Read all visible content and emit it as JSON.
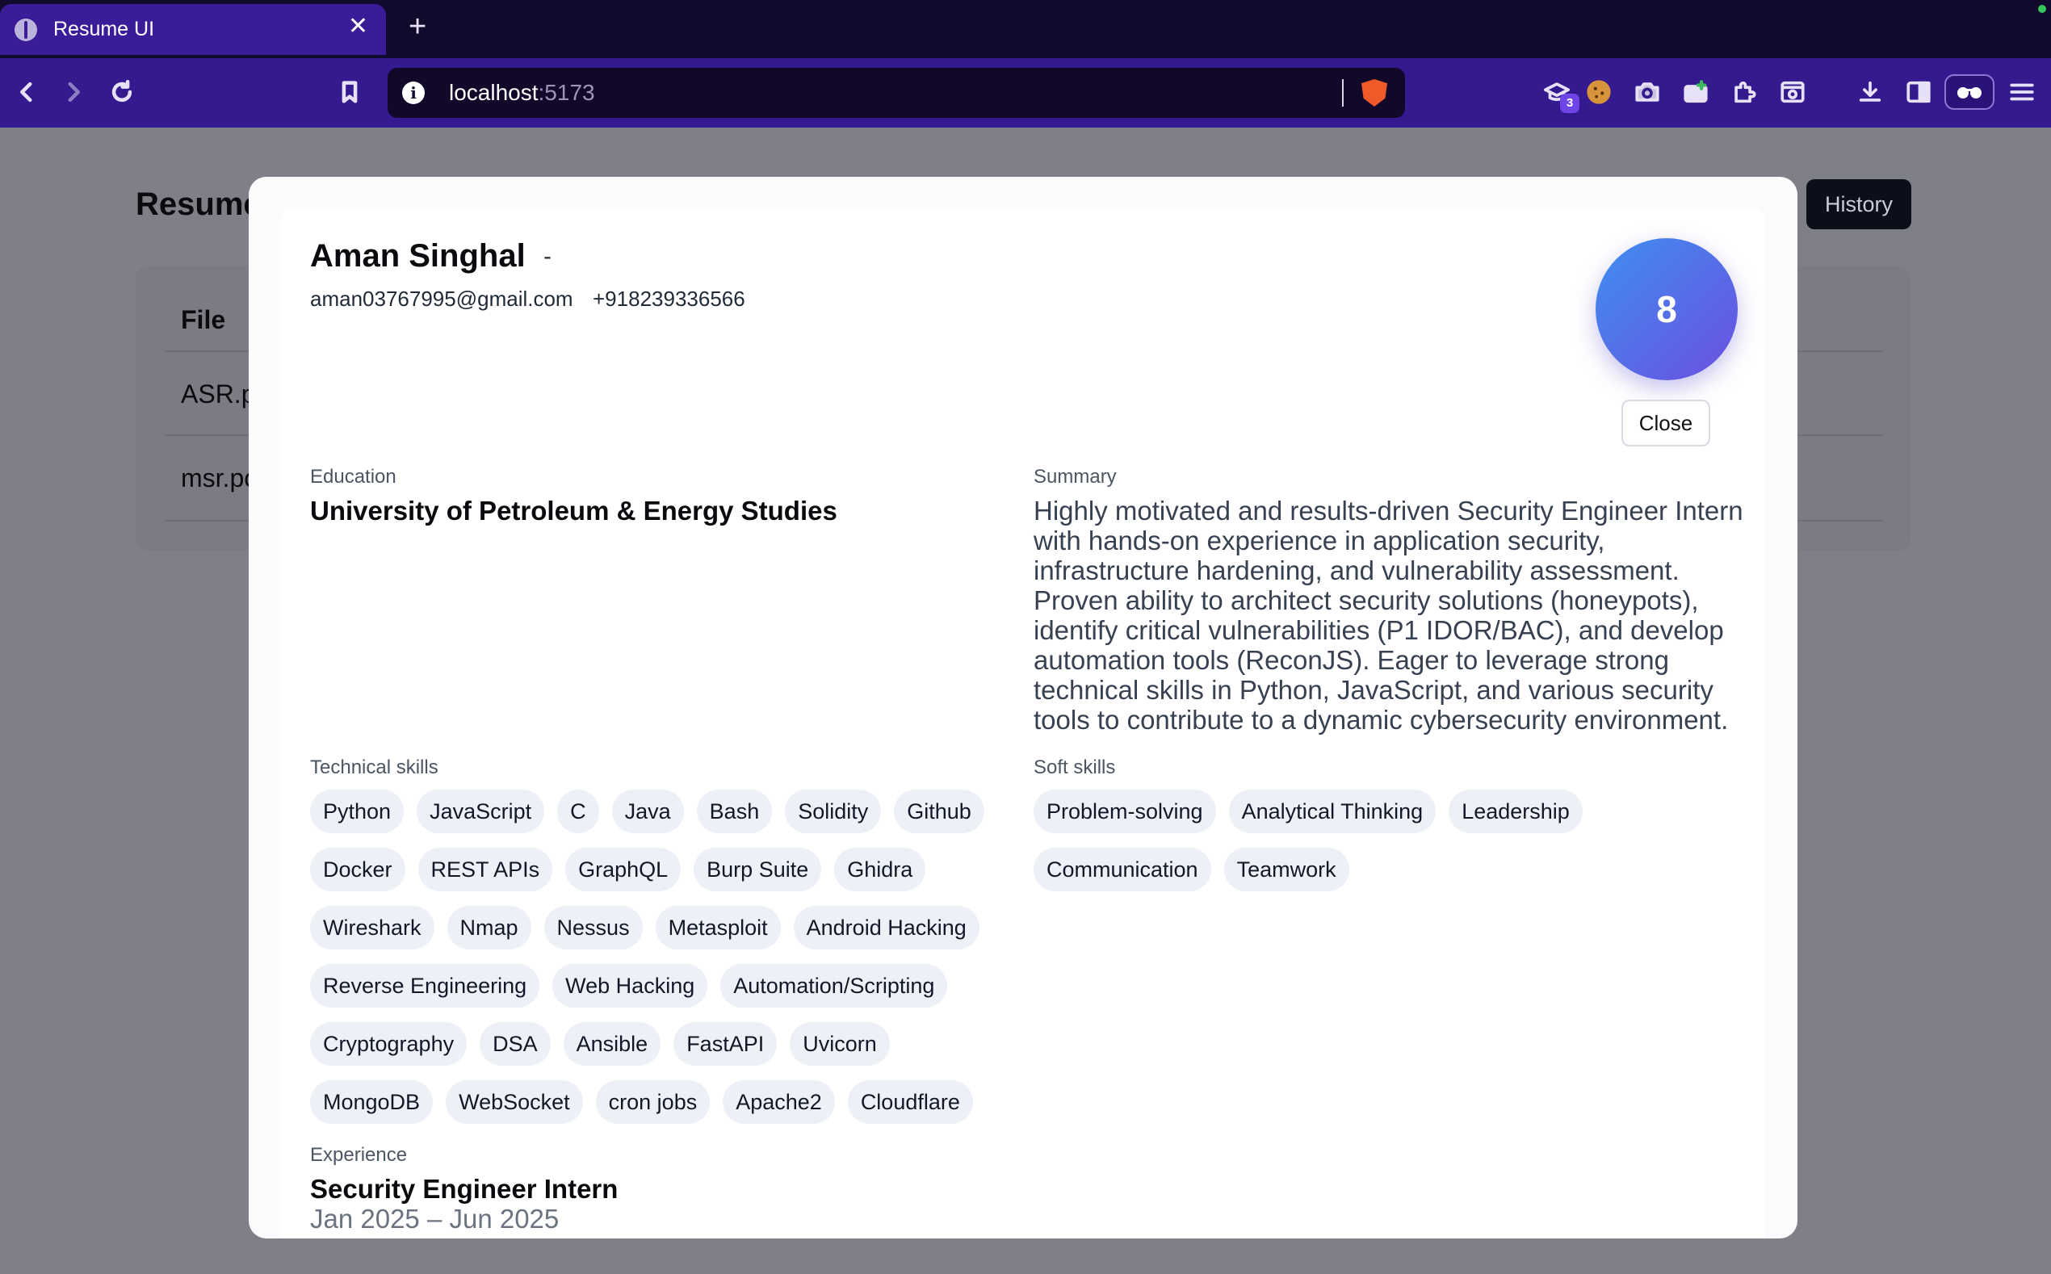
{
  "browser": {
    "tab_title": "Resume UI",
    "url_host": "localhost",
    "url_port": ":5173",
    "extension_badge": "3"
  },
  "page": {
    "title": "Resume",
    "history_label": "History",
    "table_header": "File",
    "rows": [
      "ASR.p",
      "msr.pc"
    ]
  },
  "modal": {
    "name": "Aman Singhal",
    "dash": "-",
    "email": "aman03767995@gmail.com",
    "phone": "+918239336566",
    "score": "8",
    "close_label": "Close",
    "education_label": "Education",
    "education": "University of Petroleum & Energy Studies",
    "summary_label": "Summary",
    "summary": "Highly motivated and results-driven Security Engineer Intern with hands-on experience in application security, infrastructure hardening, and vulnerability assessment. Proven ability to architect security solutions (honeypots), identify critical vulnerabilities (P1 IDOR/BAC), and develop automation tools (ReconJS). Eager to leverage strong technical skills in Python, JavaScript, and various security tools to contribute to a dynamic cybersecurity environment.",
    "technical_label": "Technical skills",
    "technical_skills": [
      "Python",
      "JavaScript",
      "C",
      "Java",
      "Bash",
      "Solidity",
      "Github",
      "Docker",
      "REST APIs",
      "GraphQL",
      "Burp Suite",
      "Ghidra",
      "Wireshark",
      "Nmap",
      "Nessus",
      "Metasploit",
      "Android Hacking",
      "Reverse Engineering",
      "Web Hacking",
      "Automation/Scripting",
      "Cryptography",
      "DSA",
      "Ansible",
      "FastAPI",
      "Uvicorn",
      "MongoDB",
      "WebSocket",
      "cron jobs",
      "Apache2",
      "Cloudflare"
    ],
    "soft_label": "Soft skills",
    "soft_skills": [
      "Problem-solving",
      "Analytical Thinking",
      "Leadership",
      "Communication",
      "Teamwork"
    ],
    "experience_label": "Experience",
    "experience_title": "Security Engineer Intern",
    "experience_dates": "Jan 2025 – Jun 2025"
  }
}
